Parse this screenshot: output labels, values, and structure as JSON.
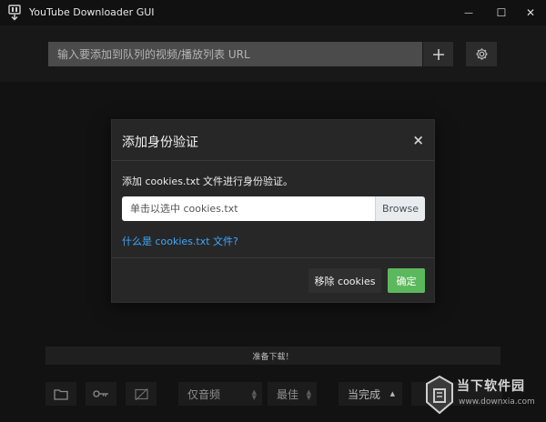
{
  "window": {
    "title": "YouTube Downloader GUI",
    "minimize_glyph": "—",
    "maximize_glyph": "☐",
    "close_glyph": "✕"
  },
  "top": {
    "url_placeholder": "输入要添加到队列的视频/播放列表 URL",
    "add_glyph": "+"
  },
  "status": {
    "text": "准备下载！"
  },
  "bottom": {
    "format_select": "仅音频",
    "quality_select": "最佳",
    "after_complete": "当完成"
  },
  "modal": {
    "title": "添加身份验证",
    "close_glyph": "×",
    "description": "添加 cookies.txt 文件进行身份验证。",
    "file_placeholder": "单击以选中 cookies.txt",
    "browse_label": "Browse",
    "help_link": "什么是 cookies.txt 文件?",
    "remove_label": "移除 cookies",
    "ok_label": "确定"
  },
  "watermark": {
    "name": "当下软件园",
    "url": "www.downxia.com"
  },
  "icons": {
    "folder": "folder-icon",
    "key": "key-icon",
    "no-image": "no-image-icon",
    "gear": "gear-icon",
    "app": "download-icon"
  }
}
